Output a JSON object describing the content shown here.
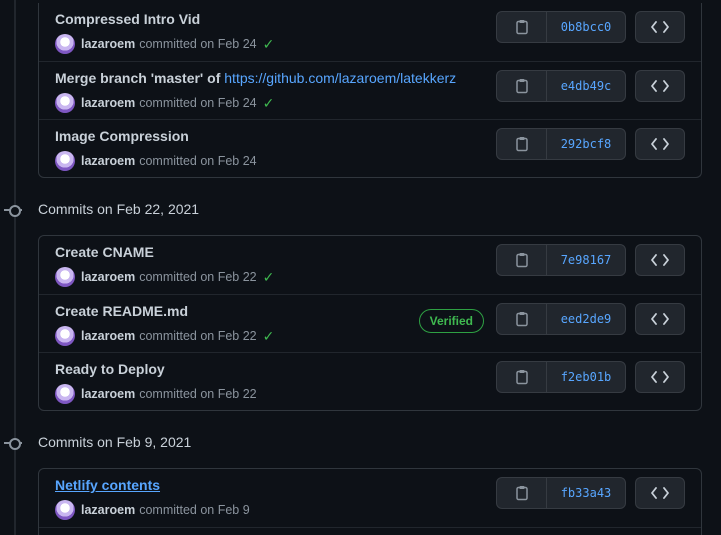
{
  "groups": [
    {
      "header": "",
      "commits": [
        {
          "title": "Compressed Intro Vid",
          "title_link": "",
          "author": "lazaroem",
          "date_text": "committed on Feb 24",
          "checked": true,
          "verified": "",
          "sha": "0b8bcc0"
        },
        {
          "title": "Merge branch 'master' of ",
          "title_link": "https://github.com/lazaroem/latekkerz",
          "author": "lazaroem",
          "date_text": "committed on Feb 24",
          "checked": true,
          "verified": "",
          "sha": "e4db49c"
        },
        {
          "title": "Image Compression",
          "title_link": "",
          "author": "lazaroem",
          "date_text": "committed on Feb 24",
          "checked": false,
          "verified": "",
          "sha": "292bcf8"
        }
      ]
    },
    {
      "header": "Commits on Feb 22, 2021",
      "commits": [
        {
          "title": "Create CNAME",
          "title_link": "",
          "author": "lazaroem",
          "date_text": "committed on Feb 22",
          "checked": true,
          "verified": "",
          "sha": "7e98167"
        },
        {
          "title": "Create README.md",
          "title_link": "",
          "author": "lazaroem",
          "date_text": "committed on Feb 22",
          "checked": true,
          "verified": "Verified",
          "sha": "eed2de9"
        },
        {
          "title": "Ready to Deploy",
          "title_link": "",
          "author": "lazaroem",
          "date_text": "committed on Feb 22",
          "checked": false,
          "verified": "",
          "sha": "f2eb01b"
        }
      ]
    },
    {
      "header": "Commits on Feb 9, 2021",
      "commits": [
        {
          "title": "Netlify contents",
          "title_link": "",
          "author": "lazaroem",
          "date_text": "committed on Feb 9",
          "checked": false,
          "verified": "",
          "sha": "fb33a43"
        }
      ]
    }
  ],
  "colors": {
    "accent": "#58a6ff",
    "success": "#3fb950",
    "background": "#0d1117",
    "border": "#30363d"
  },
  "icons": {
    "copy": "clipboard-icon",
    "browse": "code-icon",
    "check": "check-icon",
    "timeline": "commit-node-icon"
  }
}
